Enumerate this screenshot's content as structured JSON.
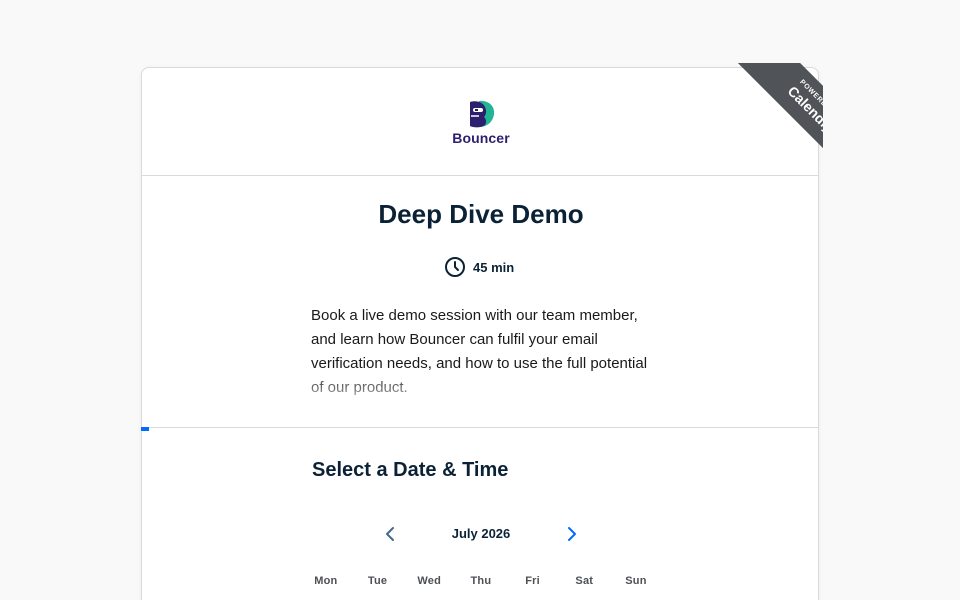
{
  "brand": {
    "logo_text": "Bouncer",
    "colors": {
      "navy": "#2c1f6e",
      "teal": "#22b494",
      "accent": "#006bff"
    }
  },
  "ribbon": {
    "small": "POWERED BY",
    "big": "Calendly"
  },
  "event": {
    "title": "Deep Dive Demo",
    "duration_icon": "clock-icon",
    "duration": "45 min",
    "description": "Book a live demo session with our team member, and learn how Bouncer can fulfil your email verification needs, and how to use the full potential of our product."
  },
  "scheduler": {
    "title": "Select a Date & Time",
    "prev_icon": "chevron-left-icon",
    "next_icon": "chevron-right-icon",
    "month": "July 2026",
    "weekdays": [
      "Mon",
      "Tue",
      "Wed",
      "Thu",
      "Fri",
      "Sat",
      "Sun"
    ]
  }
}
